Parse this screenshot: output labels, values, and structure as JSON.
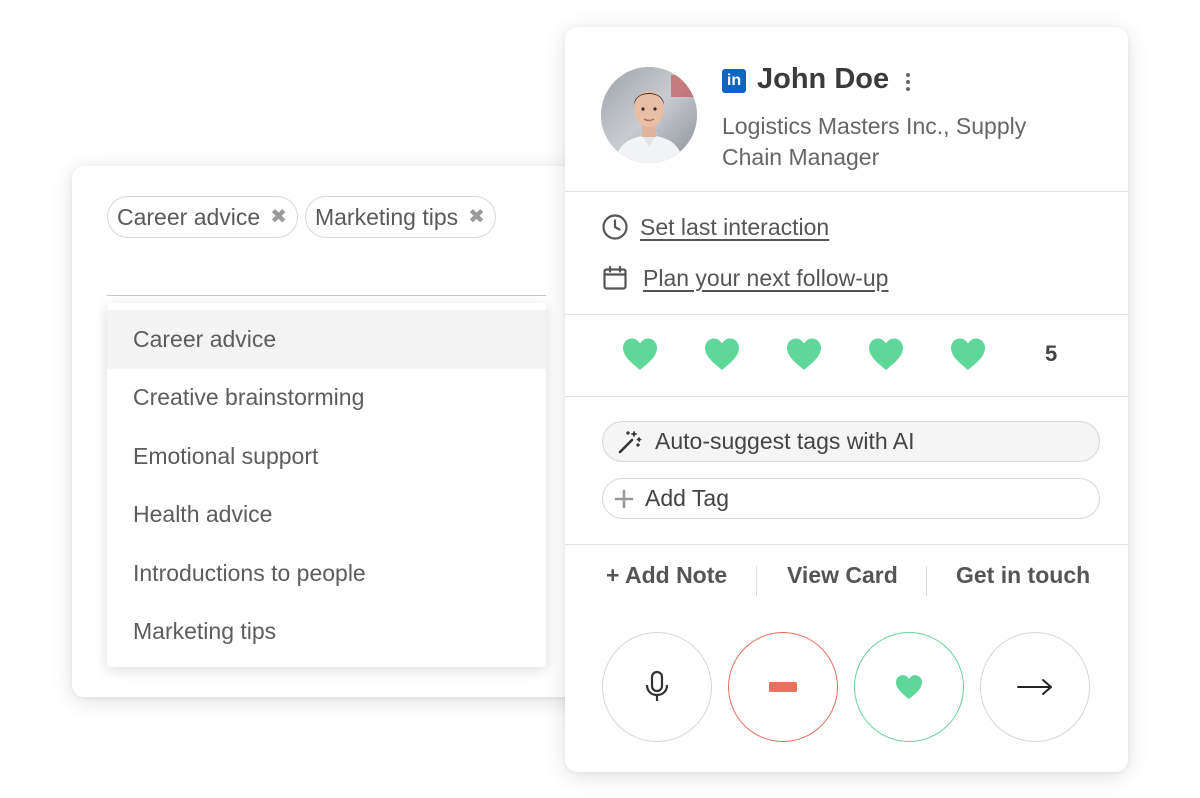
{
  "tag_selector": {
    "selected_tags": [
      {
        "label": "Career advice",
        "remove_glyph": "✖"
      },
      {
        "label": "Marketing tips",
        "remove_glyph": "✖"
      }
    ],
    "options": [
      "Career advice",
      "Creative brainstorming",
      "Emotional support",
      "Health advice",
      "Introductions to people",
      "Marketing tips"
    ],
    "highlighted_option": "Career advice"
  },
  "contact": {
    "network_badge": "in",
    "network_icon": "linkedin-icon",
    "name": "John Doe",
    "subtitle": "Logistics Masters Inc., Supply Chain Manager",
    "links": {
      "last_interaction": "Set last interaction",
      "follow_up": "Plan your next follow-up"
    },
    "rating": {
      "filled": 5,
      "max": 5,
      "value_label": "5"
    },
    "tags": {
      "ai_suggest_label": "Auto-suggest tags with AI",
      "add_tag_label": "Add Tag"
    },
    "actions": {
      "add_note": "+ Add Note",
      "view_card": "View Card",
      "get_in_touch": "Get in touch"
    },
    "controls": [
      "microphone-icon",
      "minus-icon",
      "heart-icon",
      "arrow-right-icon"
    ]
  },
  "colors": {
    "heart_green": "#5fd69a",
    "minus_red": "#ef6f5f",
    "linkedin_blue": "#0a66c2"
  }
}
